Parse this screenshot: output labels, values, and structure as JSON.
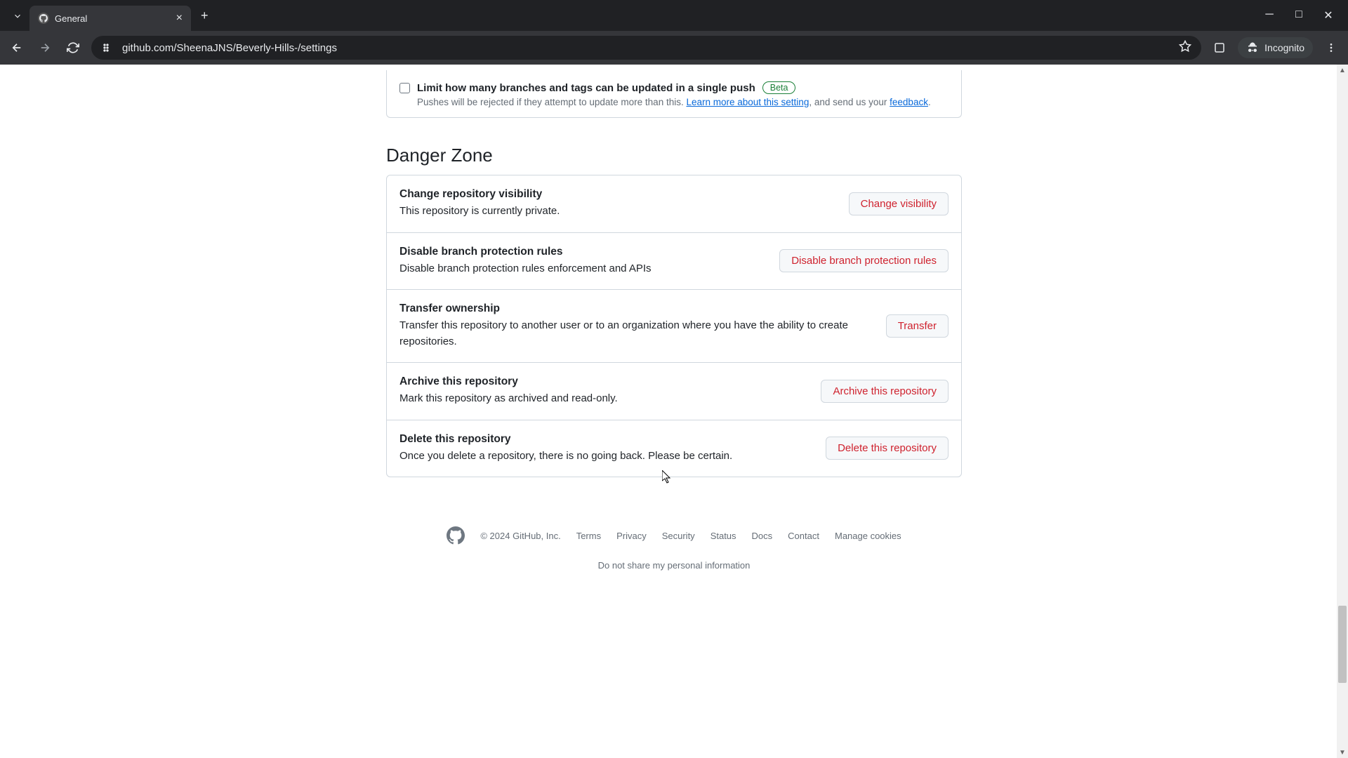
{
  "browser": {
    "tab_title": "General",
    "url": "github.com/SheenaJNS/Beverly-Hills-/settings",
    "incognito_label": "Incognito"
  },
  "push_limit": {
    "label": "Limit how many branches and tags can be updated in a single push",
    "badge": "Beta",
    "desc_prefix": "Pushes will be rejected if they attempt to update more than this. ",
    "learn_more": "Learn more about this setting",
    "desc_mid": ", and send us your ",
    "feedback": "feedback",
    "desc_suffix": "."
  },
  "danger": {
    "heading": "Danger Zone",
    "items": [
      {
        "title": "Change repository visibility",
        "desc": "This repository is currently private.",
        "button": "Change visibility"
      },
      {
        "title": "Disable branch protection rules",
        "desc": "Disable branch protection rules enforcement and APIs",
        "button": "Disable branch protection rules"
      },
      {
        "title": "Transfer ownership",
        "desc": "Transfer this repository to another user or to an organization where you have the ability to create repositories.",
        "button": "Transfer"
      },
      {
        "title": "Archive this repository",
        "desc": "Mark this repository as archived and read-only.",
        "button": "Archive this repository"
      },
      {
        "title": "Delete this repository",
        "desc": "Once you delete a repository, there is no going back. Please be certain.",
        "button": "Delete this repository"
      }
    ]
  },
  "footer": {
    "copyright": "© 2024 GitHub, Inc.",
    "links": [
      "Terms",
      "Privacy",
      "Security",
      "Status",
      "Docs",
      "Contact",
      "Manage cookies",
      "Do not share my personal information"
    ]
  }
}
